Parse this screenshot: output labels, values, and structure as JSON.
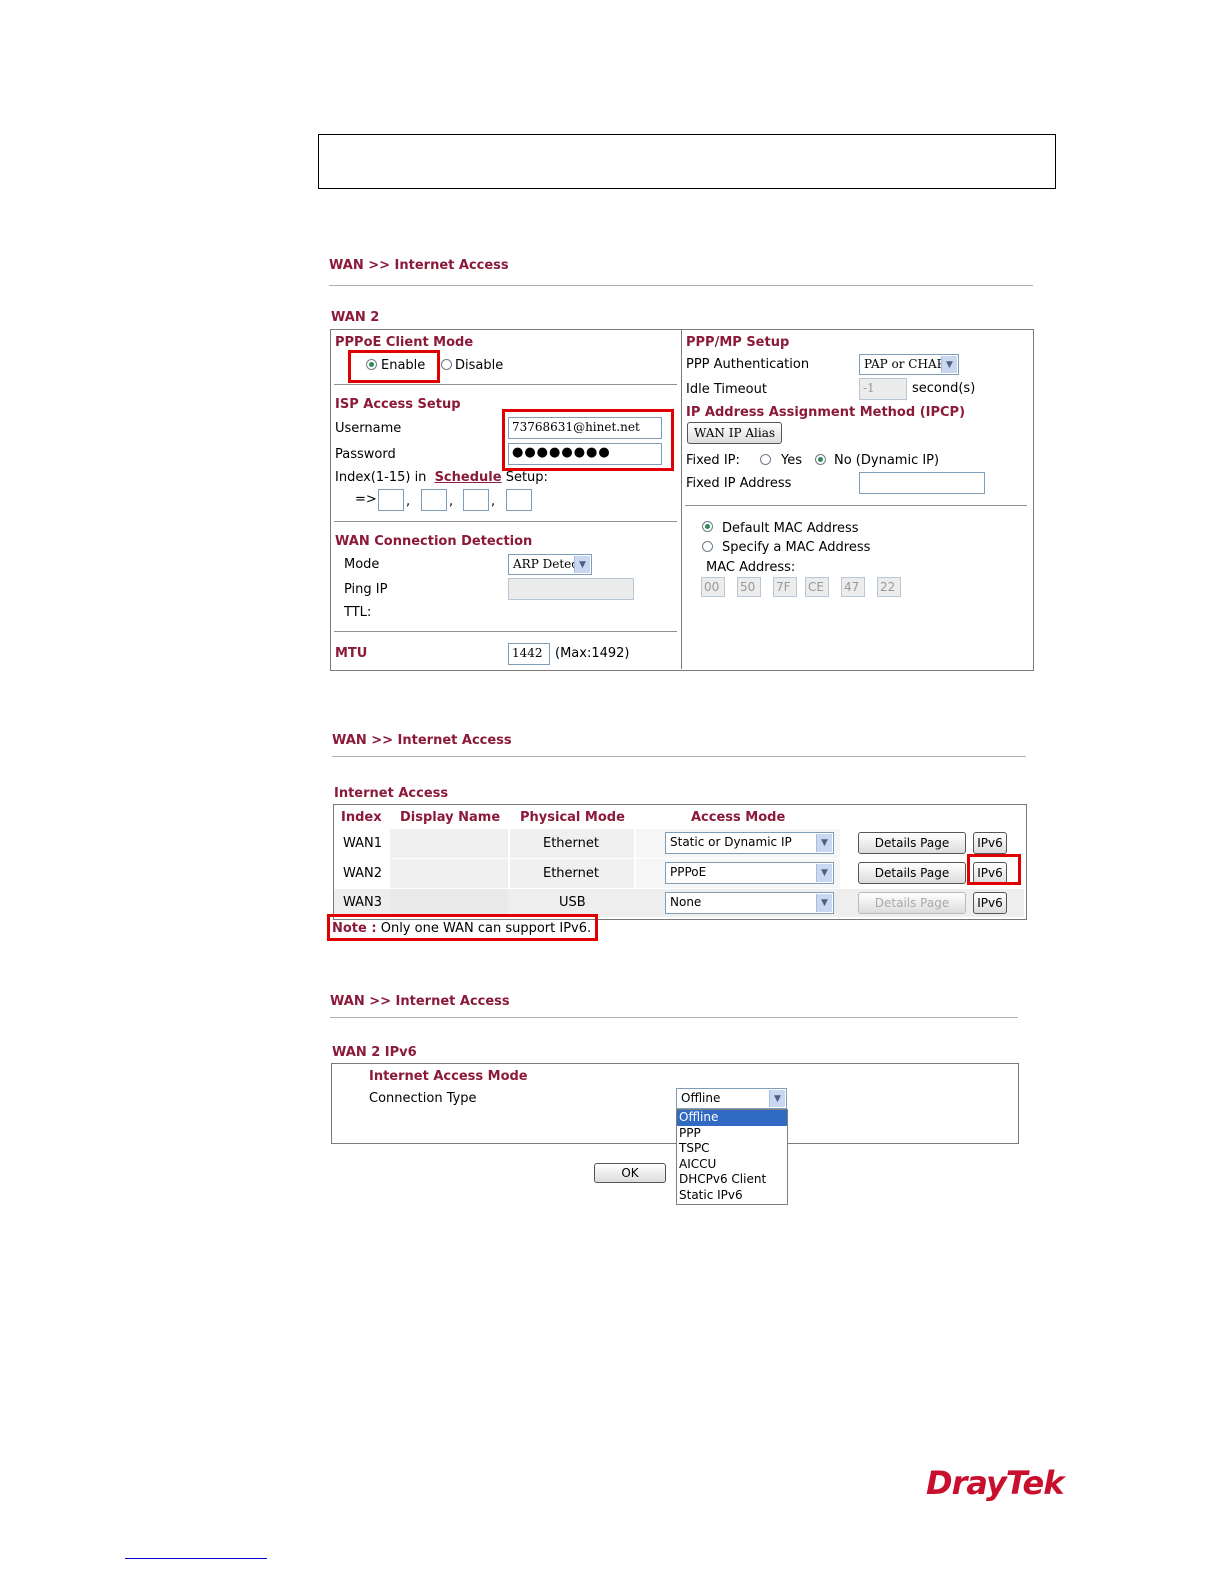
{
  "top_box": "",
  "section1": {
    "breadcrumb": "WAN >> Internet Access",
    "title": "WAN 2",
    "pppoe": {
      "heading": "PPPoE Client Mode",
      "enable_label": "Enable",
      "disable_label": "Disable",
      "selected": "Enable"
    },
    "isp": {
      "heading": "ISP Access Setup",
      "username_label": "Username",
      "username_value": "73768631@hinet.net",
      "password_label": "Password",
      "password_value": "●●●●●●●●",
      "index_prefix": "Index(1-15) in",
      "schedule_link": "Schedule",
      "index_suffix": "Setup:",
      "arrow": "=>",
      "sep": ","
    },
    "detection": {
      "heading": "WAN Connection Detection",
      "mode_label": "Mode",
      "mode_value": "ARP Detect",
      "ping_label": "Ping IP",
      "ttl_label": "TTL:"
    },
    "mtu": {
      "label": "MTU",
      "value": "1442",
      "hint": "(Max:1492)"
    },
    "ppp": {
      "heading": "PPP/MP Setup",
      "auth_label": "PPP Authentication",
      "auth_value": "PAP or CHAP",
      "idle_label": "Idle Timeout",
      "idle_value": "-1",
      "idle_unit": "second(s)"
    },
    "ipcp": {
      "heading": "IP Address Assignment Method (IPCP)",
      "alias_button": "WAN IP Alias",
      "fixed_label": "Fixed IP:",
      "yes_label": "Yes",
      "no_label": "No (Dynamic IP)",
      "fixed_addr_label": "Fixed IP Address"
    },
    "mac": {
      "default_label": "Default MAC Address",
      "specify_label": "Specify a MAC Address",
      "mac_label": "MAC Address:",
      "octets": [
        "00",
        "50",
        "7F",
        "CE",
        "47",
        "22"
      ]
    }
  },
  "section2": {
    "breadcrumb": "WAN >> Internet Access",
    "title": "Internet Access",
    "headers": [
      "Index",
      "Display Name",
      "Physical Mode",
      "Access Mode"
    ],
    "rows": [
      {
        "index": "WAN1",
        "name": "",
        "physical": "Ethernet",
        "access": "Static or Dynamic IP",
        "details": "Details Page",
        "ipv6": "IPv6"
      },
      {
        "index": "WAN2",
        "name": "",
        "physical": "Ethernet",
        "access": "PPPoE",
        "details": "Details Page",
        "ipv6": "IPv6"
      },
      {
        "index": "WAN3",
        "name": "",
        "physical": "USB",
        "access": "None",
        "details": "Details Page",
        "ipv6": "IPv6"
      }
    ],
    "note_prefix": "Note :",
    "note_text": "Only one WAN can support IPv6."
  },
  "section3": {
    "breadcrumb": "WAN >> Internet Access",
    "title": "WAN 2 IPv6",
    "mode_heading": "Internet Access Mode",
    "conn_label": "Connection Type",
    "conn_value": "Offline",
    "options": [
      "Offline",
      "PPP",
      "TSPC",
      "AICCU",
      "DHCPv6 Client",
      "Static IPv6"
    ],
    "ok_button": "OK"
  },
  "brand": {
    "logo_text": "DrayTek"
  }
}
